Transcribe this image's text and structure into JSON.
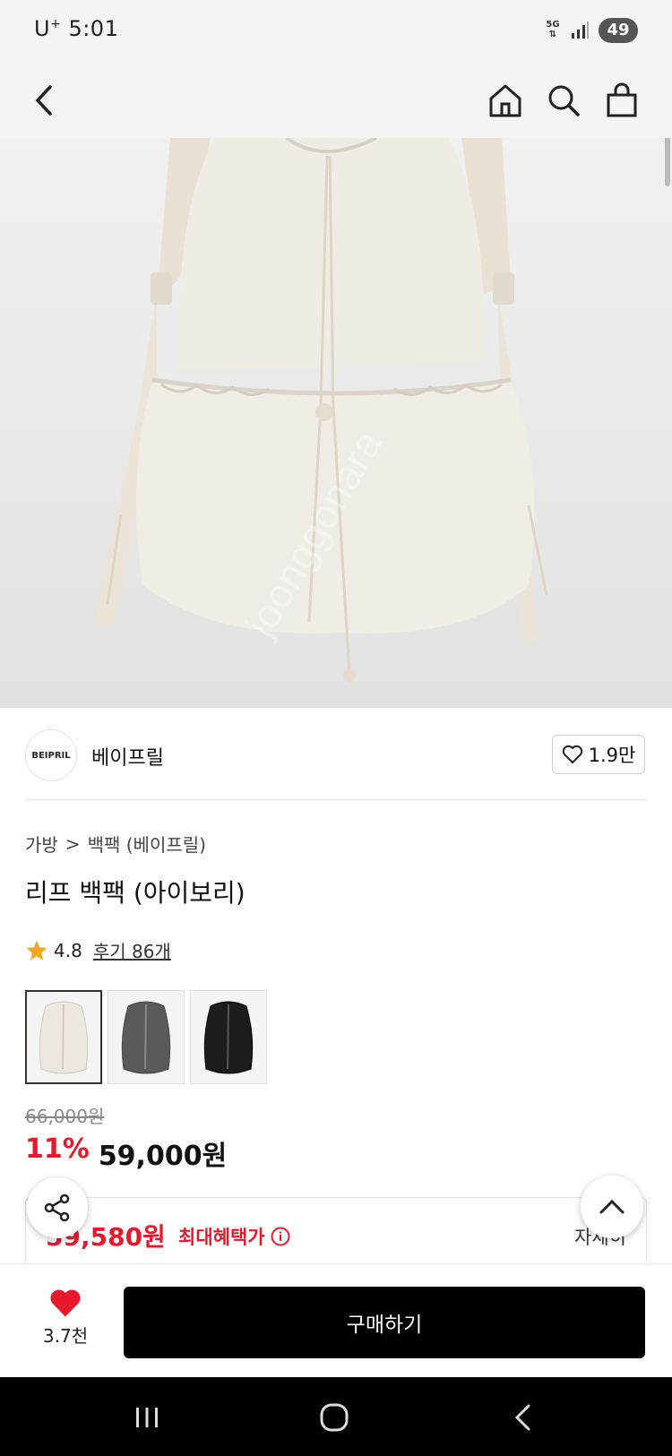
{
  "status_bar": {
    "carrier": "U",
    "carrier_sup": "+",
    "time": "5:01",
    "network": "5G",
    "battery": "49"
  },
  "app_bar": {
    "back_icon": "chevron-left-icon",
    "home_icon": "home-icon",
    "search_icon": "search-icon",
    "cart_icon": "shopping-bag-icon"
  },
  "seller": {
    "logo_text": "BEIPRIL",
    "name": "베이프릴",
    "likes": "1.9만"
  },
  "breadcrumb": {
    "category": "가방",
    "separator": ">",
    "subcategory": "백팩 (베이프릴)"
  },
  "product": {
    "title": "리프 백팩 (아이보리)",
    "rating": "4.8",
    "reviews": "후기 86개",
    "colors": [
      {
        "name": "ivory",
        "hex": "#ece8df"
      },
      {
        "name": "charcoal",
        "hex": "#5a5a58"
      },
      {
        "name": "black",
        "hex": "#1c1c1c"
      }
    ],
    "original_price": "66,000원",
    "discount": "11%",
    "price": "59,000원"
  },
  "benefit": {
    "price": "59,580원",
    "label": "최대혜택가",
    "detail": "자세히"
  },
  "bottom_bar": {
    "wish_count": "3.7천",
    "buy_label": "구매하기"
  },
  "colors": {
    "accent_red": "#e5192b",
    "buy_button": "#000000"
  }
}
